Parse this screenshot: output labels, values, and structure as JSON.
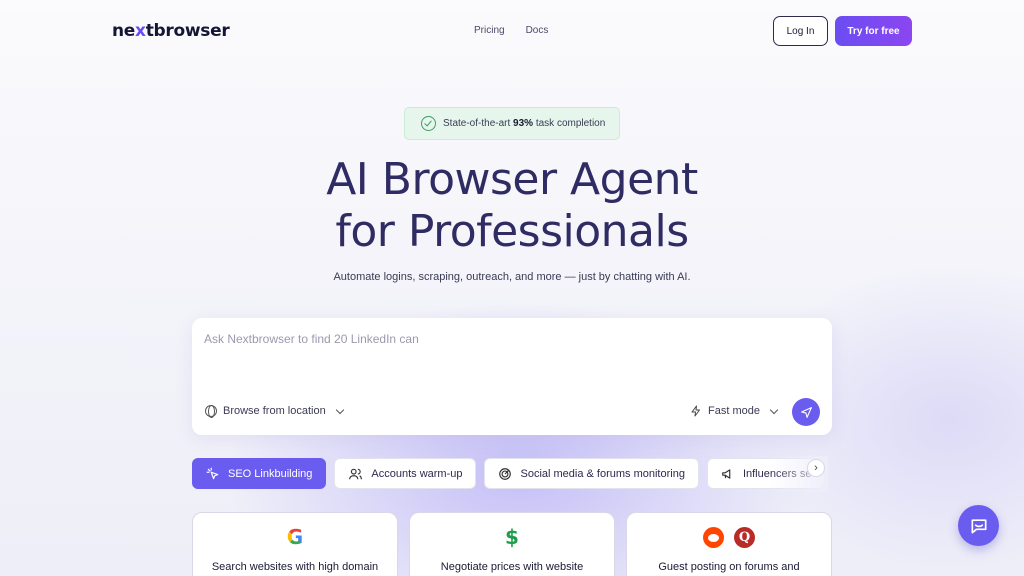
{
  "header": {
    "logo_pre": "ne",
    "logo_x": "x",
    "logo_post": "tbrowser",
    "nav": [
      "Pricing",
      "Docs"
    ],
    "login_label": "Log In",
    "try_label": "Try for free"
  },
  "badge": {
    "pre": "State-of-the-art ",
    "value": "93%",
    "post": " task completion"
  },
  "hero": {
    "title_line1": "AI Browser Agent",
    "title_line2": "for Professionals",
    "subtitle": "Automate logins, scraping, outreach, and more — just by chatting with AI."
  },
  "prompt": {
    "value": "Ask Nextbrowser to find 20 LinkedIn can",
    "location_label": "Browse from location",
    "mode_label": "Fast mode"
  },
  "chips": [
    {
      "label": "SEO Linkbuilding",
      "icon": "cursor-click-icon",
      "active": true
    },
    {
      "label": "Accounts warm-up",
      "icon": "users-icon",
      "active": false
    },
    {
      "label": "Social media & forums monitoring",
      "icon": "radar-icon",
      "active": false
    },
    {
      "label": "Influencers se",
      "icon": "megaphone-icon",
      "active": false
    }
  ],
  "cards": [
    {
      "text": "Search websites with high domain",
      "icons": [
        "google-icon"
      ]
    },
    {
      "text": "Negotiate prices with website",
      "icons": [
        "dollar-icon"
      ]
    },
    {
      "text": "Guest posting on forums and",
      "icons": [
        "reddit-icon",
        "quora-icon"
      ]
    }
  ],
  "icon_glyphs": {
    "quora": "Q",
    "dollar": "$",
    "google": "G",
    "next": "›"
  },
  "colors": {
    "accent": "#6b5cf0",
    "title": "#2f2b63",
    "badge_bg": "#e6f6ec"
  }
}
